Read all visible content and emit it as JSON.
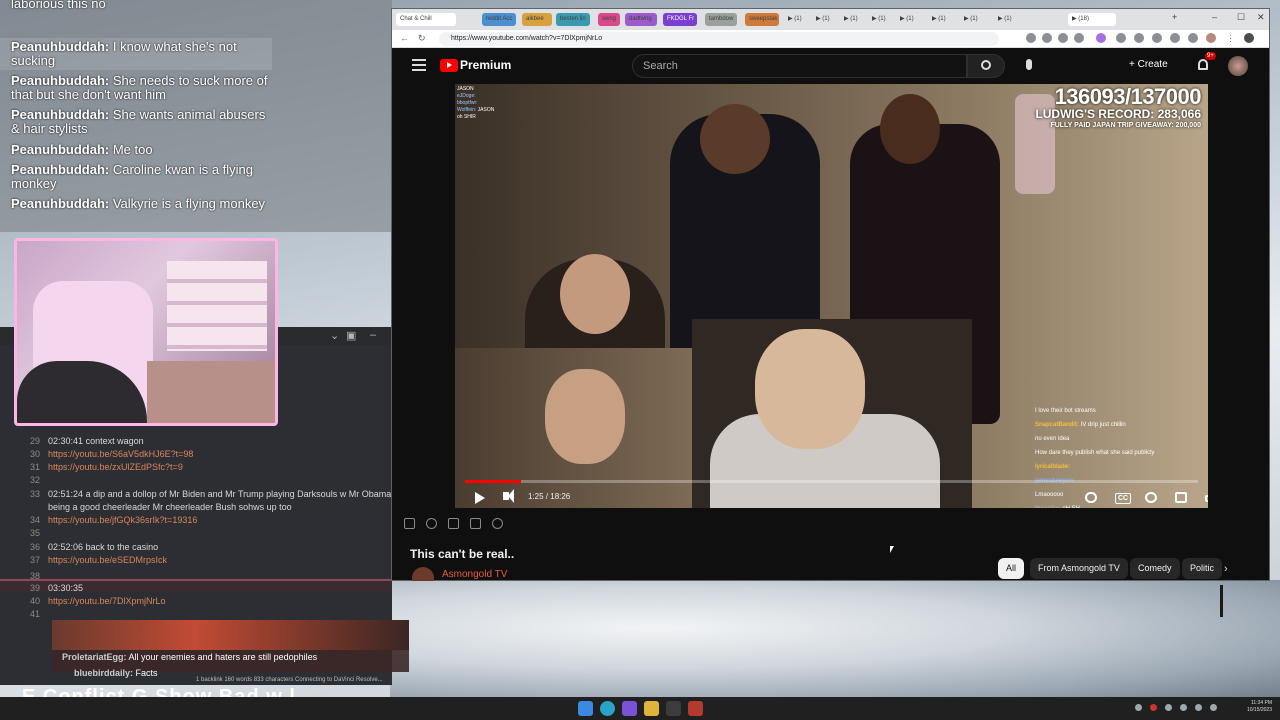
{
  "chat": {
    "first_line": "laborious this no",
    "messages": [
      {
        "user": "Peanuhbuddah:",
        "text": "I know what she's not sucking"
      },
      {
        "user": "Peanuhbuddah:",
        "text": "She needs to suck more of that but she don't want him"
      },
      {
        "user": "Peanuhbuddah:",
        "text": "She wants animal abusers & hair stylists"
      },
      {
        "user": "Peanuhbuddah:",
        "text": "Me too"
      },
      {
        "user": "Peanuhbuddah:",
        "text": "Caroline kwan is a flying monkey"
      },
      {
        "user": "Peanuhbuddah:",
        "text": "Valkyrie is a flying monkey"
      }
    ]
  },
  "notes": {
    "lines": [
      {
        "n": "29",
        "time": "02:30:41",
        "text": "context wagon",
        "link": false
      },
      {
        "n": "30",
        "time": "",
        "text": "https://youtu.be/S6aV5dkHJ6E?t=98",
        "link": true
      },
      {
        "n": "31",
        "time": "",
        "text": "https://youtu.be/zxUlZEdPSfc?t=9",
        "link": true
      },
      {
        "n": "32",
        "time": "",
        "text": "",
        "link": false
      },
      {
        "n": "33",
        "time": "02:51:24",
        "text": "a dip and a dollop of Mr Biden and Mr Trump playing Darksouls w Mr Obama",
        "link": false
      },
      {
        "n": "",
        "time": "",
        "text": "being a good cheerleader Mr cheerleader Bush sohws up too",
        "link": false
      },
      {
        "n": "34",
        "time": "",
        "text": "https://youtu.be/jfGQk36srIk?t=19316",
        "link": true
      },
      {
        "n": "35",
        "time": "",
        "text": "",
        "link": false
      },
      {
        "n": "36",
        "time": "02:52:06",
        "text": "back to the casino",
        "link": false
      },
      {
        "n": "37",
        "time": "",
        "text": "https://youtu.be/eSEDMrpsIck",
        "link": true
      },
      {
        "n": "38",
        "time": "",
        "text": "",
        "link": false
      },
      {
        "n": "39",
        "time": "03:30:35",
        "text": "",
        "link": false
      },
      {
        "n": "40",
        "time": "",
        "text": "https://youtu.be/7DlXpmjNrLo",
        "link": true
      },
      {
        "n": "41",
        "time": "",
        "text": "",
        "link": false
      }
    ],
    "status": "1 backlink   160 words  833 characters   Connecting to DaVinci Resolve..."
  },
  "chat2": {
    "messages": [
      {
        "user": "ProletariatEgg:",
        "text": "All your enemies and haters are still pedophiles"
      },
      {
        "user": "bluebirddaily:",
        "text": "Facts"
      }
    ],
    "big_text": "E Conflict   G Show Bad   w   l"
  },
  "browser": {
    "tabs": [
      "Chat & Chill",
      "reddit Acc",
      "alkbee",
      "besten lin",
      "swng",
      "dadtwng",
      "FKDGL Fr",
      "tambdow",
      "sweepstak",
      "(1)",
      "(1)",
      "(1)",
      "(1)",
      "(1)",
      "(1)",
      "(1)",
      "(1)",
      "(18)"
    ],
    "url": "https://www.youtube.com/watch?v=7DlXpmjNrLo"
  },
  "youtube": {
    "brand": "Premium",
    "search_placeholder": "Search",
    "create_label": "Create",
    "notif_badge": "9+",
    "video_title": "This can't be real..",
    "channel": "Asmongold TV",
    "time": "1:25 / 18:26",
    "progress": 0.077,
    "counter_big": "136093/137000",
    "counter_mid": "LUDWIG'S RECORD: 283,066",
    "counter_small": "FULLY PAID JAPAN TRIP GIVEAWAY: 200,000",
    "overlay_chat_tl": [
      {
        "user": "",
        "text": "JASON"
      },
      {
        "user": "eJDoge:",
        "text": ""
      },
      {
        "user": "",
        "text": ""
      },
      {
        "user": "bboptfwr:",
        "text": ""
      },
      {
        "user": "Wolffein:",
        "text": "JASON"
      },
      {
        "user": "",
        "text": "oh SHIR"
      }
    ],
    "overlay_chat_r": [
      {
        "user": "",
        "text": "I love their bot streams"
      },
      {
        "user": "SnapcatBandit:",
        "text": "IV drip just chillin"
      },
      {
        "user": "",
        "text": "no even idea"
      },
      {
        "user": "",
        "text": "How dare they publish what she said publicly"
      },
      {
        "user": "lyricalblade:",
        "text": ""
      },
      {
        "user": "jamesbeeyon:",
        "text": ""
      },
      {
        "user": "",
        "text": "Lmaooooo"
      },
      {
        "user": "theoritic:",
        "text": "oH SH"
      }
    ],
    "chips": [
      "All",
      "From Asmongold TV",
      "Comedy",
      "Politic"
    ]
  },
  "taskbar": {
    "time": "11:34 PM",
    "date": "10/15/2023"
  }
}
